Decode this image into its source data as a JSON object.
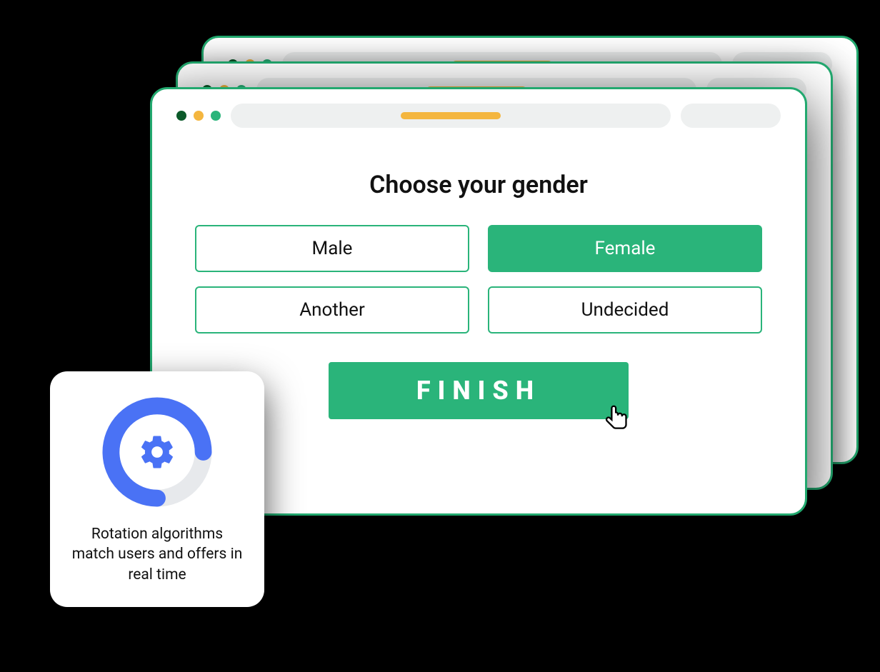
{
  "form": {
    "heading": "Choose your gender",
    "options": {
      "male": "Male",
      "female": "Female",
      "another": "Another",
      "undecided": "Undecided"
    },
    "selected": "female",
    "finish_label": "FINISH"
  },
  "card": {
    "text": "Rotation algorithms match users and offers in real time"
  },
  "colors": {
    "accent_green": "#2ab47a",
    "accent_yellow": "#f4b63f",
    "ring_blue": "#4a72f5"
  }
}
